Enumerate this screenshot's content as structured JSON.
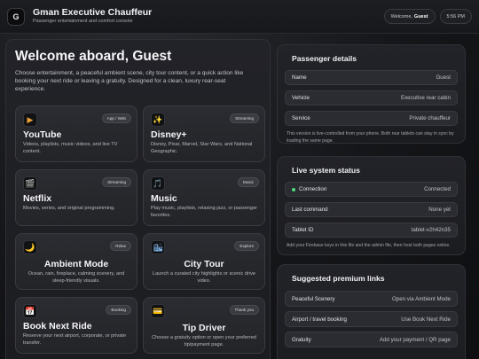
{
  "header": {
    "logo_letter": "G",
    "title": "Gman Executive Chauffeur",
    "subtitle": "Passenger entertainment and comfort console",
    "welcome_prefix": "Welcome,",
    "guest_name": "Guest",
    "time": "5:56 PM"
  },
  "main": {
    "title": "Welcome aboard, Guest",
    "description": "Choose entertainment, a peaceful ambient scene, city tour content, or a quick action like booking your next ride or leaving a gratuity. Designed for a clean, luxury rear-seat experience.",
    "tiles": [
      {
        "icon": "play-icon",
        "glyph": "▶",
        "glyph_color": "#f0a23a",
        "badge": "App / Web",
        "title": "YouTube",
        "desc": "Videos, playlists, music videos, and live TV content."
      },
      {
        "icon": "sparkles-icon",
        "glyph": "✨",
        "glyph_color": "#f5c542",
        "badge": "Streaming",
        "title": "Disney+",
        "desc": "Disney, Pixar, Marvel, Star Wars, and National Geographic."
      },
      {
        "icon": "clapperboard-icon",
        "glyph": "🎬",
        "glyph_color": "#e8e8ec",
        "badge": "Streaming",
        "title": "Netflix",
        "desc": "Movies, series, and original programming."
      },
      {
        "icon": "music-note-icon",
        "glyph": "🎵",
        "glyph_color": "#e8e8ec",
        "badge": "Music",
        "title": "Music",
        "desc": "Play music, playlists, relaxing jazz, or passenger favorites."
      },
      {
        "icon": "moon-icon",
        "glyph": "🌙",
        "glyph_color": "#f5c542",
        "badge": "Relax",
        "title": "Ambient Mode",
        "desc": "Ocean, rain, fireplace, calming scenery, and sleep-friendly visuals."
      },
      {
        "icon": "city-icon",
        "glyph": "🏙",
        "glyph_color": "#7fb3e6",
        "badge": "Explore",
        "title": "City Tour",
        "desc": "Launch a curated city highlights or scenic drive video."
      },
      {
        "icon": "calendar-icon",
        "glyph": "📅",
        "glyph_color": "#e55b4d",
        "badge": "Booking",
        "title": "Book Next Ride",
        "desc": "Reserve your next airport, corporate, or private transfer."
      },
      {
        "icon": "credit-card-icon",
        "glyph": "💳",
        "glyph_color": "#f5c542",
        "badge": "Thank you",
        "title": "Tip Driver",
        "desc": "Choose a gratuity option or open your preferred tip/payment page."
      }
    ]
  },
  "passenger": {
    "title": "Passenger details",
    "rows": [
      {
        "label": "Name",
        "value": "Guest"
      },
      {
        "label": "Vehicle",
        "value": "Executive rear cabin"
      },
      {
        "label": "Service",
        "value": "Private chauffeur"
      }
    ],
    "note": "This version is live-controlled from your phone. Both rear tablets can stay in sync by loading the same page."
  },
  "status": {
    "title": "Live system status",
    "rows": [
      {
        "label": "Connection",
        "value": "Connected"
      },
      {
        "label": "Last command",
        "value": "None yet"
      },
      {
        "label": "Tablet ID",
        "value": "tablet-v2h42n35"
      }
    ],
    "note": "Add your Firebase keys in this file and the admin file, then host both pages online.",
    "connected_color": "#4fdc7f"
  },
  "premium": {
    "title": "Suggested premium links",
    "rows": [
      {
        "label": "Peaceful Scenery",
        "value": "Open via Ambient Mode"
      },
      {
        "label": "Airport / travel booking",
        "value": "Use Book Next Ride"
      },
      {
        "label": "Gratuity",
        "value": "Add your payment / QR page"
      }
    ]
  }
}
